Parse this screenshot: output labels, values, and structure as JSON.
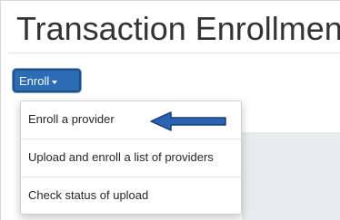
{
  "page": {
    "title": "Transaction Enrollment"
  },
  "enroll_button": {
    "label": "Enroll",
    "icon": "caret-down-icon",
    "color": "#2b6cb4"
  },
  "dropdown": {
    "items": [
      {
        "label": "Enroll a provider"
      },
      {
        "label": "Upload and enroll a list of providers"
      },
      {
        "label": "Check status of upload"
      }
    ]
  },
  "annotation": {
    "icon": "left-arrow-icon",
    "color": "#2a61b0"
  }
}
